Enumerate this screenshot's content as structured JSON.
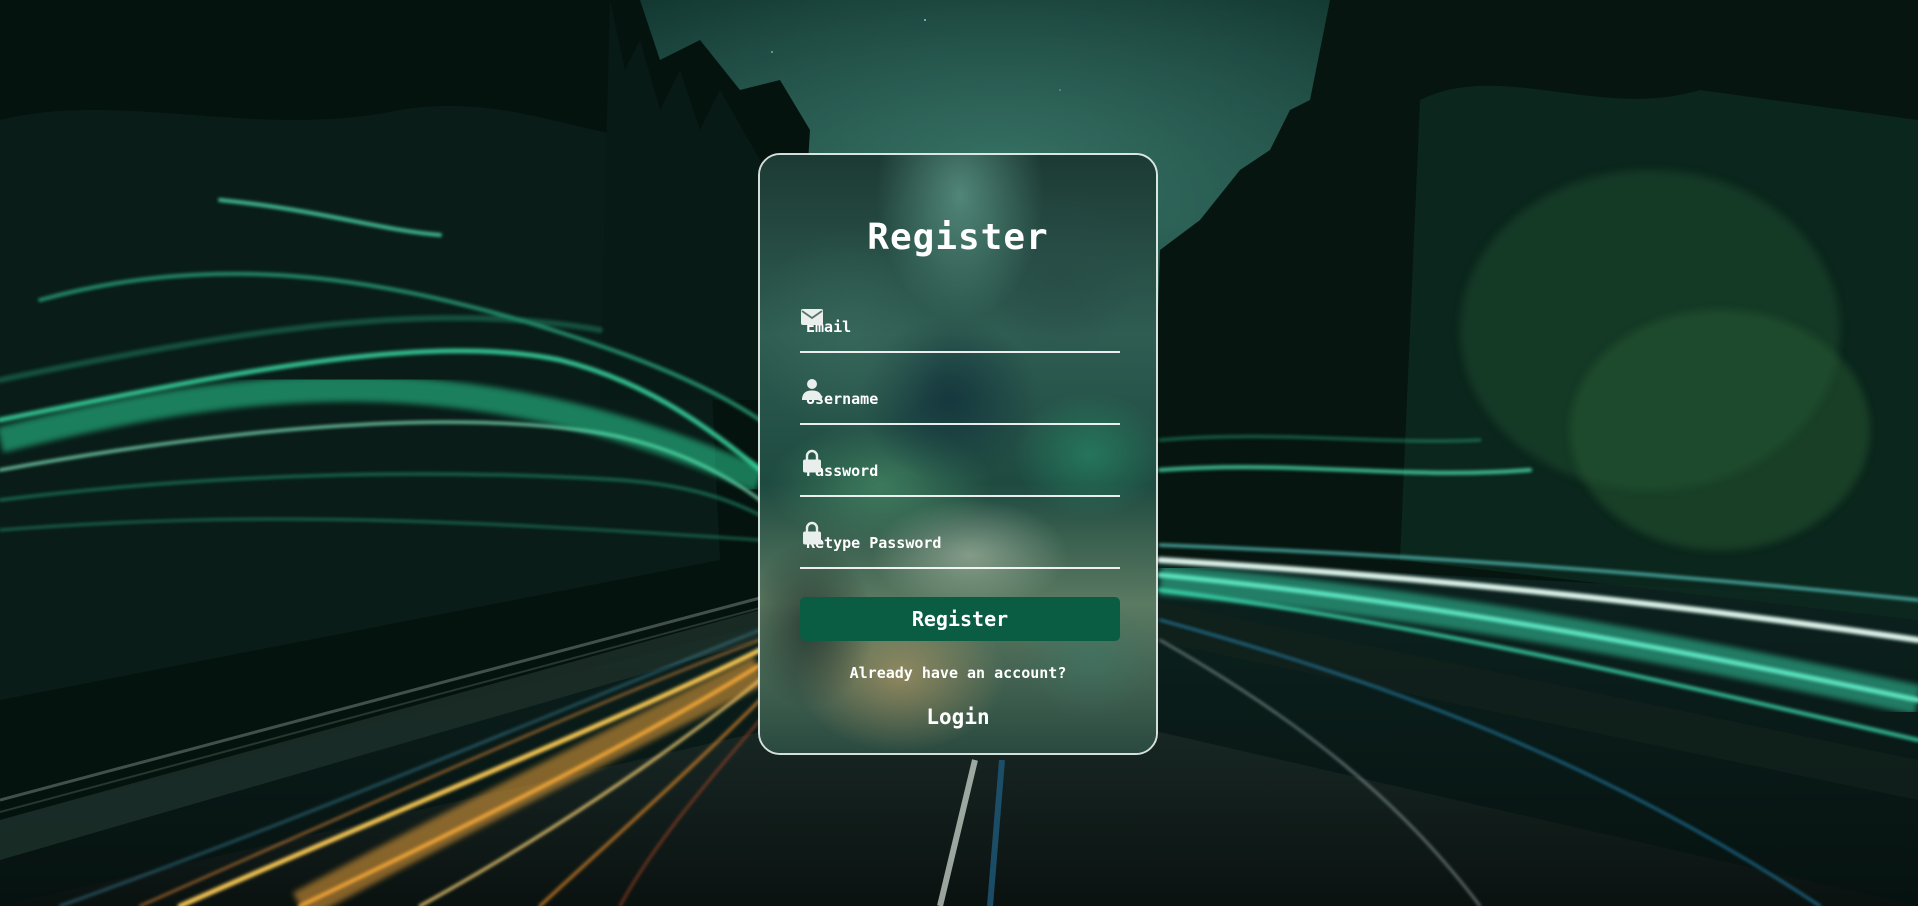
{
  "form": {
    "title": "Register",
    "fields": [
      {
        "name": "email",
        "placeholder": "Email",
        "value": "",
        "icon": "envelope-icon"
      },
      {
        "name": "username",
        "placeholder": "Username",
        "value": "",
        "icon": "user-icon"
      },
      {
        "name": "password",
        "placeholder": "Password",
        "value": "",
        "icon": "lock-icon"
      },
      {
        "name": "retype_password",
        "placeholder": "Retype Password",
        "value": "",
        "icon": "lock-icon"
      }
    ],
    "submit_label": "Register",
    "login_prompt": "Already have an account?",
    "login_label": "Login"
  },
  "colors": {
    "button": "#0a5c43",
    "text": "#ffffff",
    "card_border": "#ebf5f0",
    "accent_green": "#3ee8b0",
    "accent_amber": "#f5b53c"
  }
}
